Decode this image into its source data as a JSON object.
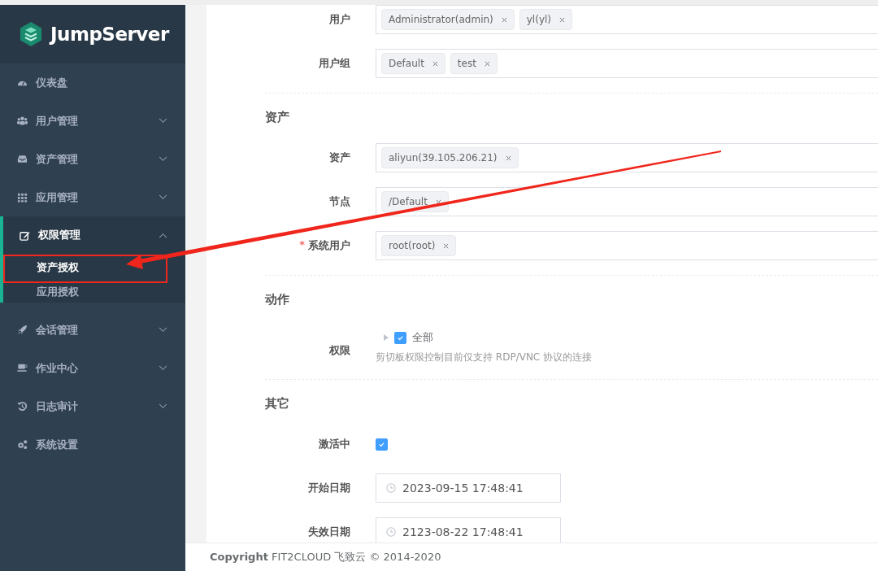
{
  "sidebar": {
    "logo": "JumpServer",
    "items": [
      {
        "label": "仪表盘",
        "kind": "link"
      },
      {
        "label": "用户管理",
        "kind": "group",
        "expanded": false
      },
      {
        "label": "资产管理",
        "kind": "group",
        "expanded": false
      },
      {
        "label": "应用管理",
        "kind": "group",
        "expanded": false
      },
      {
        "label": "权限管理",
        "kind": "group",
        "expanded": true,
        "children": [
          {
            "label": "资产授权",
            "selected": true
          },
          {
            "label": "应用授权",
            "selected": false
          }
        ]
      },
      {
        "label": "会话管理",
        "kind": "group",
        "expanded": false
      },
      {
        "label": "作业中心",
        "kind": "group",
        "expanded": false
      },
      {
        "label": "日志审计",
        "kind": "group",
        "expanded": false
      },
      {
        "label": "系统设置",
        "kind": "link"
      }
    ]
  },
  "form": {
    "sections": [
      {
        "fields": [
          {
            "label": "用户",
            "kind": "tags",
            "tags": [
              "Administrator(admin)",
              "yl(yl)"
            ]
          },
          {
            "label": "用户组",
            "kind": "tags",
            "tags": [
              "Default",
              "test"
            ]
          }
        ]
      },
      {
        "title": "资产",
        "fields": [
          {
            "label": "资产",
            "kind": "tags",
            "tags": [
              "aliyun(39.105.206.21)"
            ]
          },
          {
            "label": "节点",
            "kind": "tags",
            "tags": [
              "/Default"
            ]
          },
          {
            "label": "系统用户",
            "kind": "tags",
            "required_mark": "*",
            "tags": [
              "root(root)"
            ]
          }
        ]
      },
      {
        "title": "动作",
        "fields": [
          {
            "label": "权限",
            "kind": "tree",
            "option": "全部",
            "checked": true,
            "hint": "剪切板权限控制目前仅支持 RDP/VNC 协议的连接"
          }
        ]
      },
      {
        "title": "其它",
        "fields": [
          {
            "label": "激活中",
            "kind": "checkbox",
            "checked": true
          },
          {
            "label": "开始日期",
            "kind": "datetime",
            "value": "2023-09-15 17:48:41"
          },
          {
            "label": "失效日期",
            "kind": "datetime",
            "value": "2123-08-22 17:48:41"
          }
        ]
      }
    ]
  },
  "footer": {
    "text": "**Copyright** FIT2CLOUD 飞致云 © 2014-2020"
  }
}
